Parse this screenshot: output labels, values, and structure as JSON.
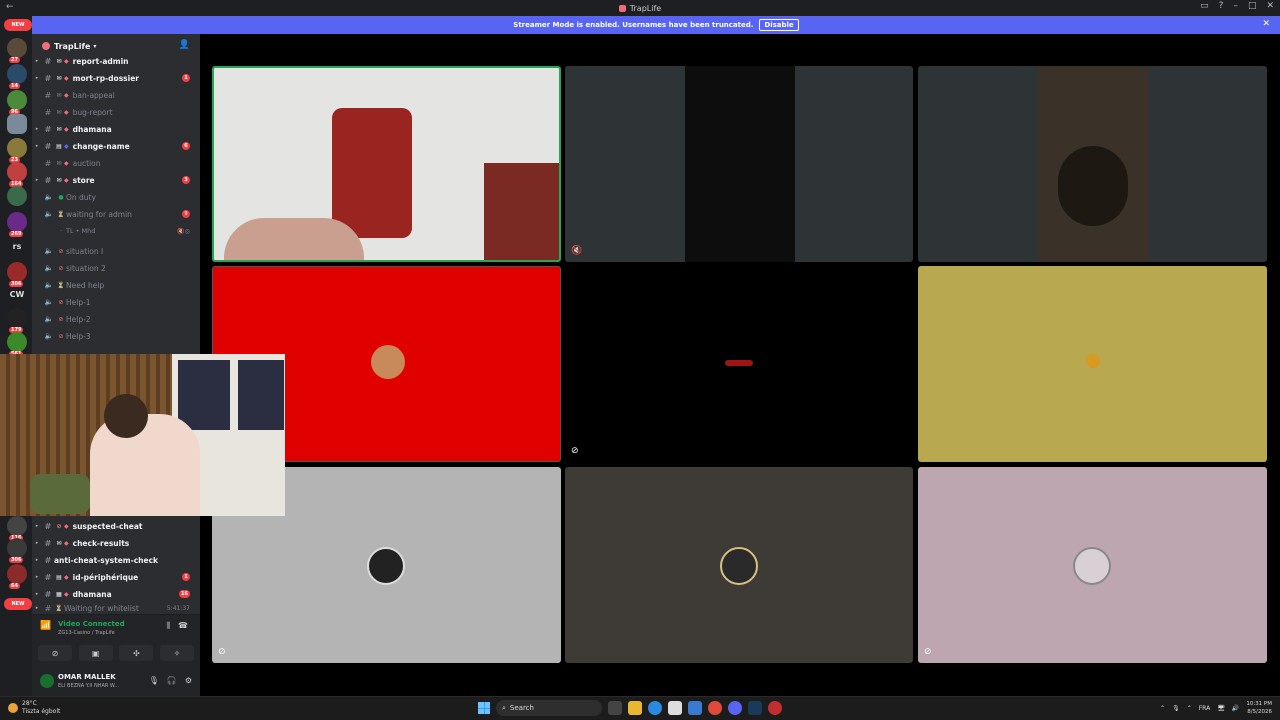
{
  "window": {
    "title": "TrapLife"
  },
  "banner": {
    "text": "Streamer Mode is enabled. Usernames have been truncated.",
    "button": "Disable"
  },
  "servers": {
    "new_label": "NEW",
    "badges": [
      "27",
      "14",
      "96",
      "23",
      "164",
      "269",
      "306",
      "179",
      "561",
      "116",
      "306",
      "64"
    ],
    "text_icons": [
      "rs",
      "CW"
    ]
  },
  "guild": {
    "name": "TrapLife"
  },
  "channels": [
    {
      "name": "report-admin",
      "badge": ""
    },
    {
      "name": "mort-rp-dossier",
      "badge": "1"
    },
    {
      "name": "ban-appeal",
      "badge": ""
    },
    {
      "name": "bug-report",
      "badge": ""
    },
    {
      "name": "dhamana",
      "badge": ""
    },
    {
      "name": "change-name",
      "badge": "6"
    },
    {
      "name": "auction",
      "badge": ""
    },
    {
      "name": "store",
      "badge": "3"
    }
  ],
  "voice_channels": [
    {
      "name": "On duty",
      "badge": ""
    },
    {
      "name": "waiting for admin",
      "badge": "9"
    },
    {
      "name": "TL • Mhd",
      "badge": ""
    },
    {
      "name": "situation I",
      "badge": ""
    },
    {
      "name": "situation 2",
      "badge": ""
    },
    {
      "name": "Need help",
      "badge": ""
    },
    {
      "name": "Help-1",
      "badge": ""
    },
    {
      "name": "Help-2",
      "badge": ""
    },
    {
      "name": "Help-3",
      "badge": ""
    }
  ],
  "lower_channels": [
    {
      "name": "suspected-cheat",
      "badge": ""
    },
    {
      "name": "check-results",
      "badge": ""
    },
    {
      "name": "anti-cheat-system-check",
      "badge": ""
    },
    {
      "name": "id-périphérique",
      "badge": "1"
    },
    {
      "name": "dhamana",
      "badge": "16"
    },
    {
      "name": "Waiting for whitelist",
      "time": "5:41:37"
    }
  ],
  "voice_panel": {
    "status": "Video Connected",
    "location": "ZG13-Casino / TrapLife"
  },
  "user": {
    "name": "OMAR MALLEK",
    "status": "ELI BEZNA Y.II NHAR W..."
  },
  "colors": {
    "accent": "#5865f2",
    "red_tile": "#e00000",
    "yellow_tile": "#b8a850",
    "grey_tile": "#b4b4b4",
    "brown_tile": "#3e3a35",
    "pink_tile": "#bea6b0",
    "speaking": "#23a55a"
  },
  "taskbar": {
    "weather_temp": "28°C",
    "weather_text": "Tiszta égbolt",
    "search": "Search",
    "lang": "FRA",
    "time": "10:31 PM",
    "date": "8/5/2026"
  }
}
